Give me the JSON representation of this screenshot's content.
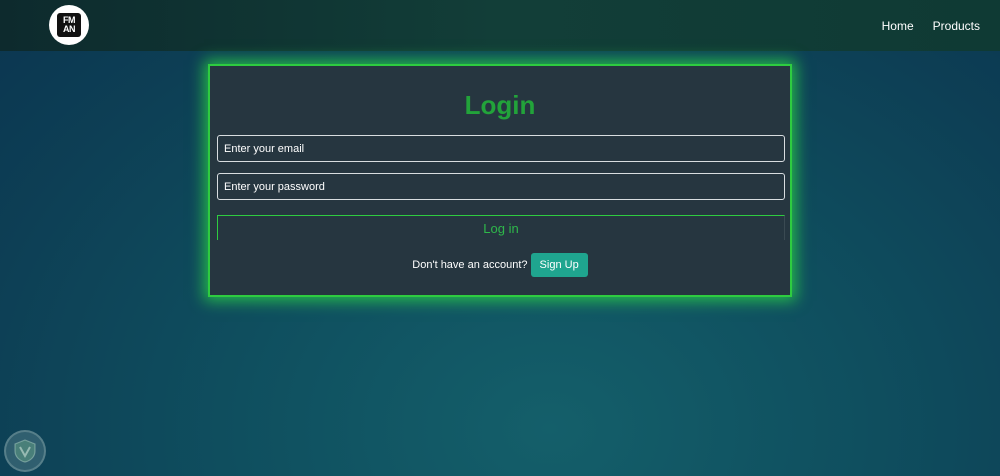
{
  "navbar": {
    "logo_text_top": "FM",
    "logo_text_bottom": "AN",
    "links": [
      {
        "label": "Home"
      },
      {
        "label": "Products"
      }
    ]
  },
  "login_card": {
    "title": "Login",
    "email_placeholder": "Enter your email",
    "password_placeholder": "Enter your password",
    "login_button_label": "Log in",
    "signup_prompt": "Don't have an account?",
    "signup_button_label": "Sign Up"
  },
  "colors": {
    "accent_green": "#22a33a",
    "glow_green": "#2ecc40",
    "signup_teal": "#1fa58f",
    "card_bg": "#263640"
  },
  "icons": {
    "logo": "brand-logo-icon",
    "watermark": "shield-watermark-icon"
  }
}
